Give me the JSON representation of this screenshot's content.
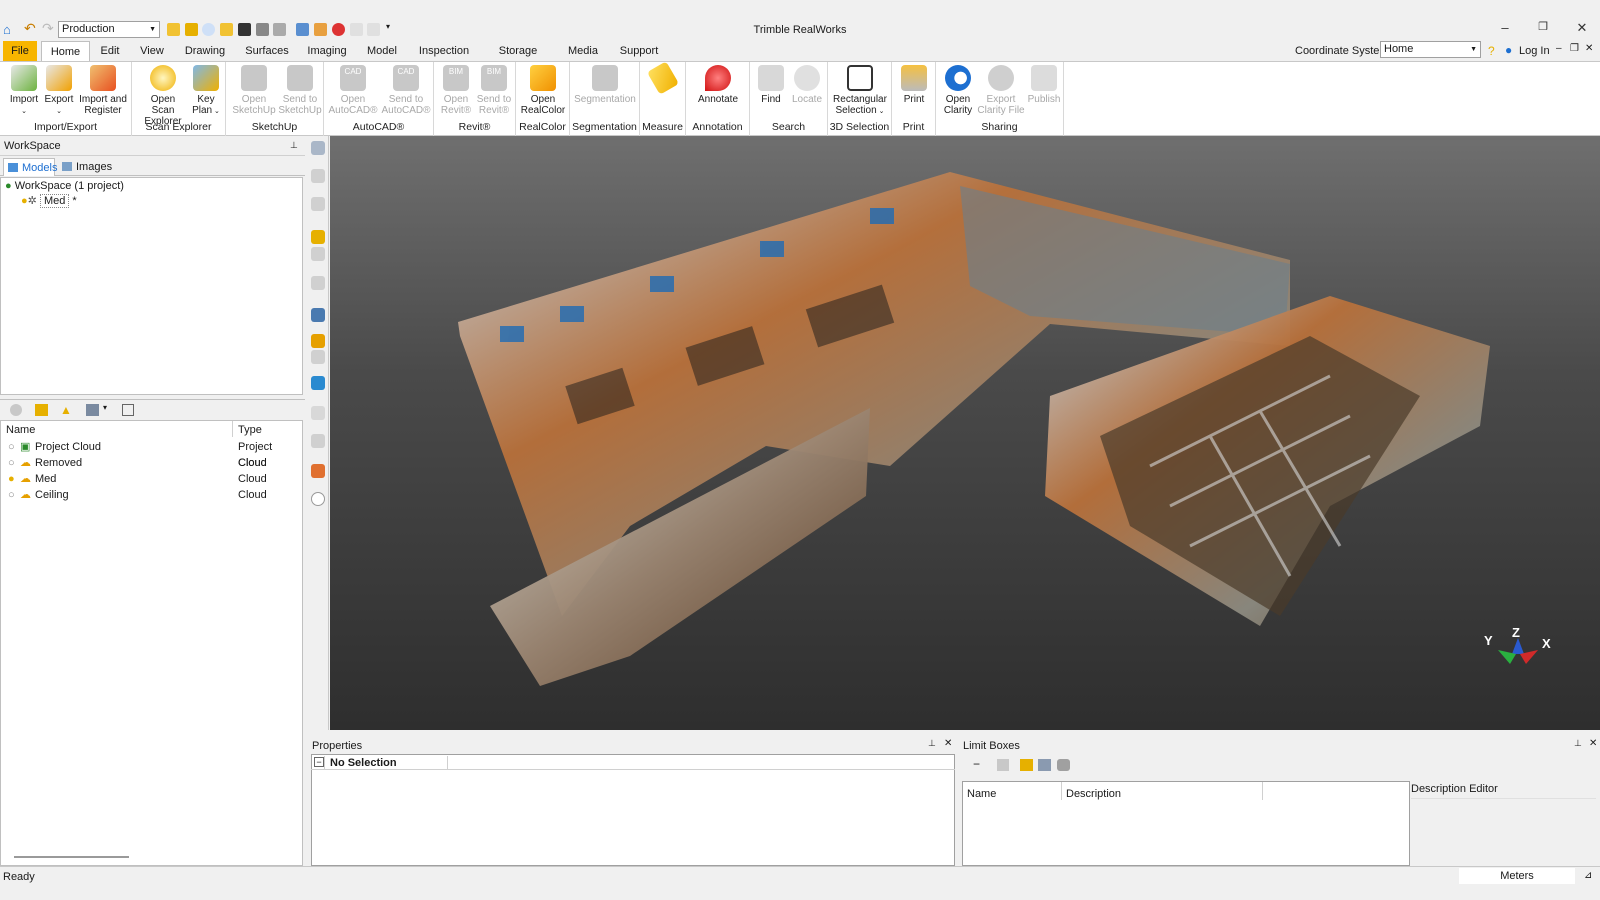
{
  "app": {
    "title": "Trimble RealWorks"
  },
  "quick_access": {
    "profile": "Production"
  },
  "menu": {
    "items": [
      "File",
      "Home",
      "Edit",
      "View",
      "Drawing",
      "Surfaces",
      "Imaging",
      "Model",
      "Inspection",
      "Storage Tank",
      "Media",
      "Support"
    ]
  },
  "coordinate": {
    "label": "Coordinate System",
    "value": "Home"
  },
  "login": {
    "label": "Log In"
  },
  "ribbon": {
    "groups": {
      "import_export": "Import/Export",
      "scan_explorer": "Scan Explorer",
      "sketchup": "SketchUp",
      "autocad": "AutoCAD®",
      "revit": "Revit®",
      "realcolor": "RealColor",
      "segmentation": "Segmentation",
      "measure": "Measure",
      "annotation": "Annotation",
      "search": "Search",
      "selection": "3D Selection",
      "print": "Print",
      "sharing": "Sharing"
    },
    "buttons": {
      "import": "Import",
      "export": "Export",
      "import_register_1": "Import and",
      "import_register_2": "Register",
      "open_scan_1": "Open Scan",
      "open_scan_2": "Explorer",
      "key_plan_1": "Key",
      "key_plan_2": "Plan",
      "open_sketchup_1": "Open",
      "open_sketchup_2": "SketchUp",
      "send_sketchup_1": "Send to",
      "send_sketchup_2": "SketchUp",
      "open_autocad_1": "Open",
      "open_autocad_2": "AutoCAD®",
      "send_autocad_1": "Send to",
      "send_autocad_2": "AutoCAD®",
      "open_revit_1": "Open",
      "open_revit_2": "Revit®",
      "send_revit_1": "Send to",
      "send_revit_2": "Revit®",
      "open_realcolor_1": "Open",
      "open_realcolor_2": "RealColor",
      "segmentation": "Segmentation",
      "annotate": "Annotate",
      "find": "Find",
      "locate": "Locate",
      "rect_sel_1": "Rectangular",
      "rect_sel_2": "Selection",
      "print": "Print",
      "open_clarity_1": "Open",
      "open_clarity_2": "Clarity",
      "export_clarity_1": "Export",
      "export_clarity_2": "Clarity File",
      "publish": "Publish",
      "cad_badge": "CAD",
      "bim_badge": "BIM"
    }
  },
  "workspace": {
    "title": "WorkSpace",
    "tabs": [
      "Models",
      "Images"
    ],
    "root": "WorkSpace  (1 project)",
    "child": "Med",
    "child_marker": "*"
  },
  "layers": {
    "columns": [
      "Name",
      "Type"
    ],
    "rows": [
      {
        "name": "Project Cloud",
        "type": "Project Cloud"
      },
      {
        "name": "Removed",
        "type": "Cloud"
      },
      {
        "name": "Med",
        "type": "Cloud"
      },
      {
        "name": "Ceiling",
        "type": "Cloud"
      }
    ]
  },
  "axes": {
    "x": "X",
    "y": "Y",
    "z": "Z"
  },
  "properties": {
    "title": "Properties",
    "selection": "No Selection"
  },
  "limit_boxes": {
    "title": "Limit Boxes",
    "columns": [
      "Name",
      "Description"
    ],
    "editor": "Description Editor"
  },
  "status": {
    "text": "Ready",
    "units": "Meters"
  }
}
